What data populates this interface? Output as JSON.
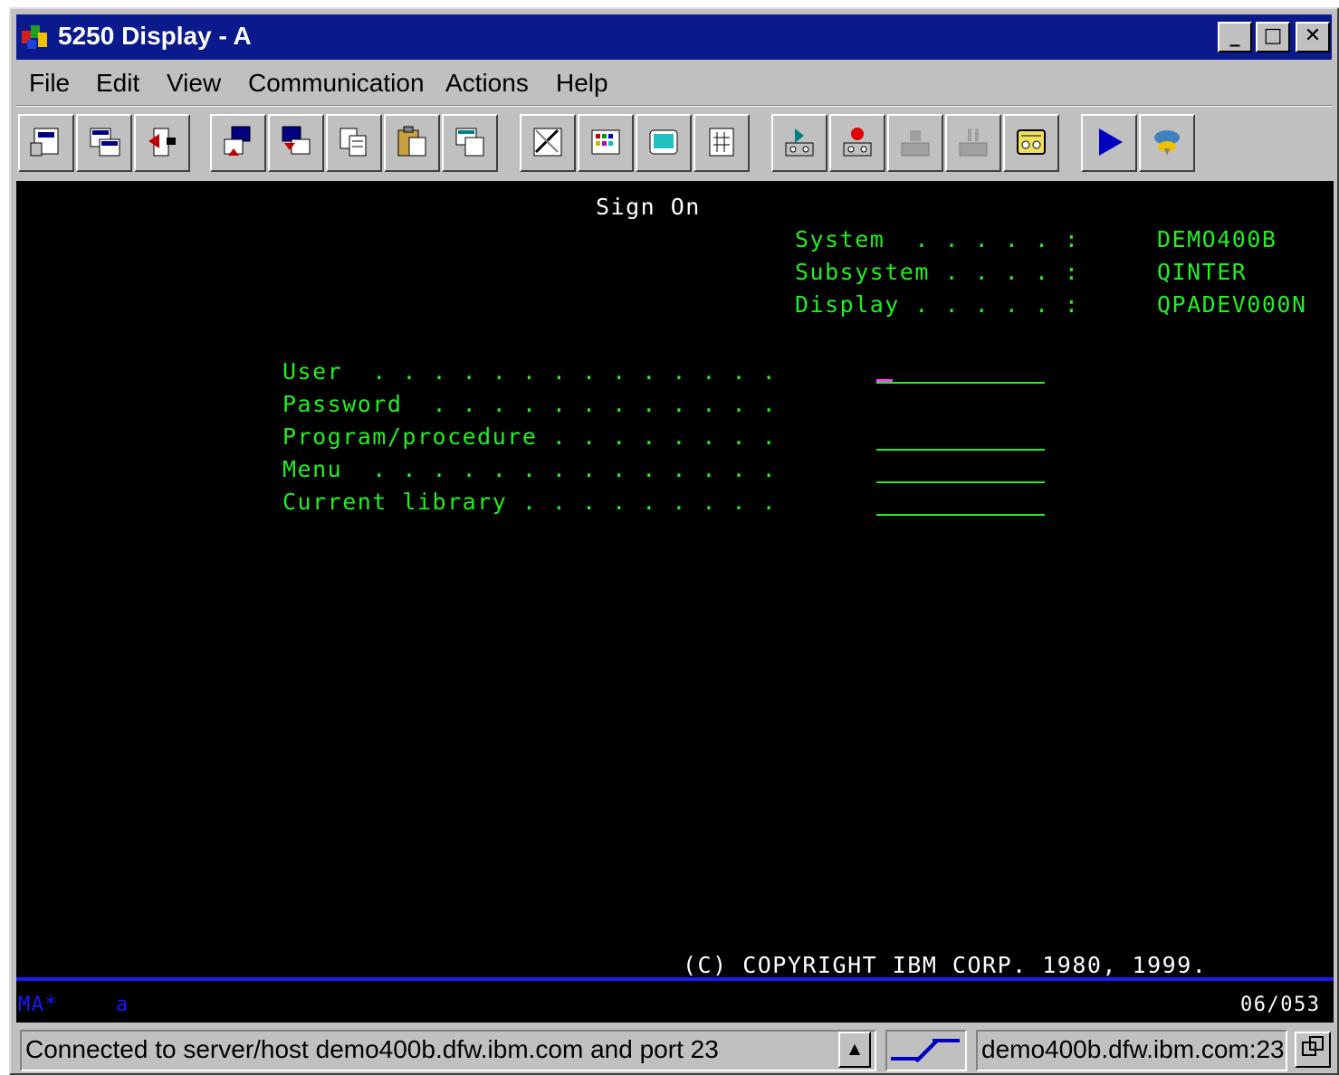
{
  "window": {
    "title": "5250 Display - A",
    "controls": {
      "minimize": "_",
      "maximize": "□",
      "close": "✕"
    }
  },
  "menu": {
    "items": [
      "File",
      "Edit",
      "View",
      "Communication",
      "Actions",
      "Help"
    ]
  },
  "toolbar": {
    "buttons": [
      "print-screen-icon",
      "print-setup-icon",
      "disconnect-icon",
      "send-icon",
      "receive-icon",
      "copy-icon",
      "paste-icon",
      "edit-paste-icon",
      "macro-icon",
      "color-map-icon",
      "keyboard-map-icon",
      "keypad-icon",
      "play-macro-icon",
      "record-macro-icon",
      "stop-macro-icon",
      "pause-macro-icon",
      "tape-icon",
      "run-icon",
      "help-icon"
    ]
  },
  "screen": {
    "title": "Sign On",
    "system_label": "System  . . . . . :",
    "system_value": "DEMO400B",
    "subsystem_label": "Subsystem . . . . :",
    "subsystem_value": "QINTER",
    "display_label": "Display . . . . . :",
    "display_value": "QPADEV000N",
    "fields": [
      {
        "label": "User  . . . . . . . . . . . . . .",
        "value": ""
      },
      {
        "label": "Password  . . . . . . . . . . . .",
        "value": ""
      },
      {
        "label": "Program/procedure . . . . . . . .",
        "value": ""
      },
      {
        "label": "Menu  . . . . . . . . . . . . . .",
        "value": ""
      },
      {
        "label": "Current library . . . . . . . . .",
        "value": ""
      }
    ],
    "copyright": "(C) COPYRIGHT IBM CORP. 1980, 1999."
  },
  "oia": {
    "indicator": "MA*",
    "mode": "a",
    "cursor_position": "06/053"
  },
  "statusbar": {
    "message": "Connected to server/host demo400b.dfw.ibm.com and port 23",
    "host": "demo400b.dfw.ibm.com:23"
  },
  "colors": {
    "screen_bg": "#000000",
    "field_green": "#22ee22",
    "oia_blue": "#1a1aff",
    "titlebar": "#0a1a8c"
  }
}
